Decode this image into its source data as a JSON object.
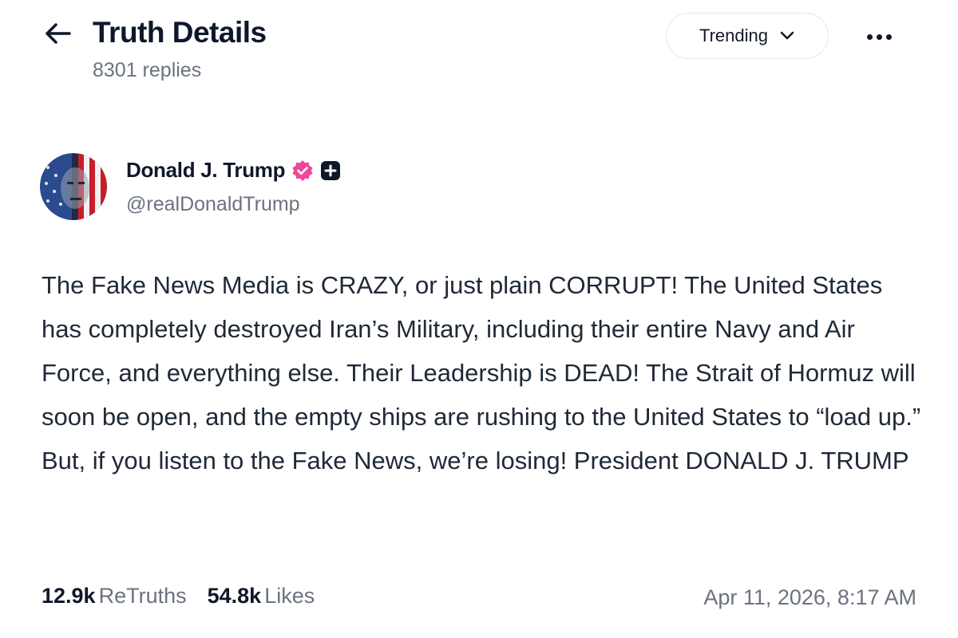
{
  "header": {
    "title": "Truth Details",
    "replies": "8301 replies",
    "sort_label": "Trending"
  },
  "author": {
    "name": "Donald J. Trump",
    "handle": "@realDonaldTrump",
    "verified_color": "#ec4899"
  },
  "post": {
    "text": "The Fake News Media is CRAZY, or just plain CORRUPT! The United States has completely destroyed Iran’s Military, including their entire Navy and Air Force, and everything else. Their Leadership is DEAD! The Strait of Hormuz will soon be open, and the empty ships are rushing to the United States to “load up.” But, if you listen to the Fake News, we’re losing! President DONALD J. TRUMP",
    "retruths_count": "12.9k",
    "retruths_label": "ReTruths",
    "likes_count": "54.8k",
    "likes_label": "Likes",
    "timestamp": "Apr 11, 2026, 8:17 AM"
  },
  "icons": {
    "back": "arrow-left-icon",
    "sort": "chevron-down-icon",
    "more": "more-horizontal-icon",
    "verified": "verified-badge-icon",
    "plus": "plus-badge-icon"
  }
}
